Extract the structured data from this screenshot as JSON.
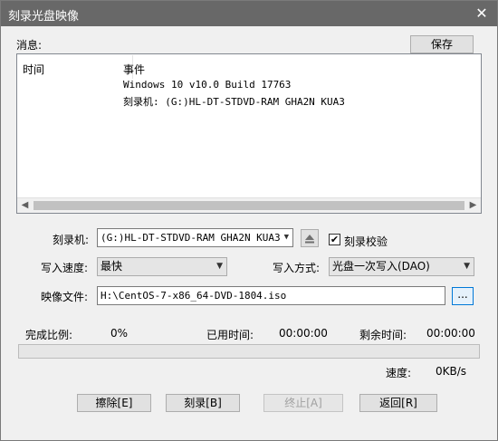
{
  "window": {
    "title": "刻录光盘映像",
    "close_glyph": "✕"
  },
  "messages": {
    "label": "消息:",
    "save_label": "保存",
    "columns": [
      "时间",
      "事件"
    ],
    "events": [
      "Windows 10 v10.0 Build 17763",
      "刻录机: (G:)HL-DT-STDVD-RAM GHA2N   KUA3"
    ]
  },
  "burner": {
    "label": "刻录机:",
    "value": "(G:)HL-DT-STDVD-RAM GHA2N   KUA3",
    "eject_icon": "eject-icon"
  },
  "verify": {
    "label": "刻录校验",
    "checked": true
  },
  "speed": {
    "label": "写入速度:",
    "value": "最快"
  },
  "write_mode": {
    "label": "写入方式:",
    "value": "光盘一次写入(DAO)"
  },
  "image_file": {
    "label": "映像文件:",
    "value": "H:\\CentOS-7-x86_64-DVD-1804.iso",
    "browse_label": "..."
  },
  "status": {
    "complete_label": "完成比例:",
    "complete_value": "0%",
    "elapsed_label": "已用时间:",
    "elapsed_value": "00:00:00",
    "remaining_label": "剩余时间:",
    "remaining_value": "00:00:00",
    "progress_fraction": 0,
    "speed_label": "速度:",
    "speed_value": "0KB/s"
  },
  "buttons": {
    "erase": "擦除[E]",
    "burn": "刻录[B]",
    "stop": "终止[A]",
    "back": "返回[R]"
  },
  "colors": {
    "titlebar": "#686868",
    "progress_fill": "#06b025"
  }
}
